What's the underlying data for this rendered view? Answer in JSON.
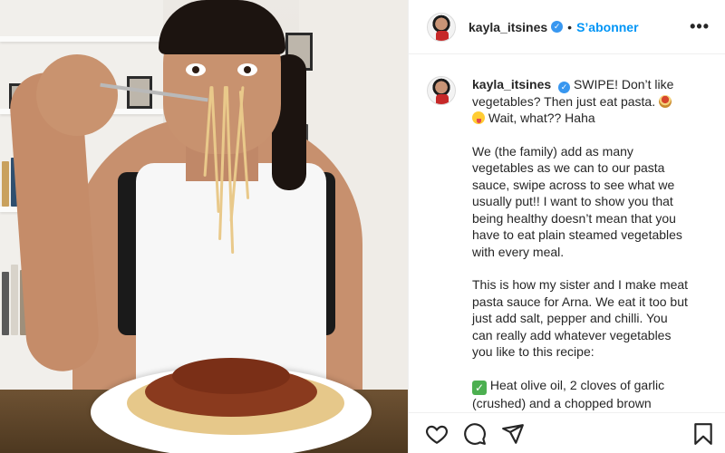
{
  "post": {
    "username": "kayla_itsines",
    "verified_icon": "verified-badge-icon",
    "separator": "•",
    "follow_label": "S’abonner",
    "more_icon": "more-options-icon"
  },
  "caption": {
    "username": "kayla_itsines",
    "line1_a": "SWIPE! Don’t like vegetables? Then just eat pasta.",
    "line1_b": "Wait, what?? Haha",
    "para2": "We (the family) add as many vegetables as we can to our pasta sauce, swipe across to see what we usually put!! I want to show you that being healthy doesn’t mean that you have to eat plain steamed vegetables with every meal.",
    "para3": "This is how my sister and I make meat pasta sauce for Arna. We eat it too but just add salt, pepper and chilli. You can really add whatever vegetables you like to this recipe:",
    "para4": "Heat olive oil, 2 cloves of garlic (crushed) and a chopped brown",
    "emoji_1": "spaghetti-emoji-icon",
    "emoji_2": "tongue-out-emoji-icon",
    "emoji_3": "check-mark-emoji-icon"
  },
  "actions": {
    "like_icon": "heart-icon",
    "comment_icon": "comment-icon",
    "share_icon": "share-icon",
    "save_icon": "bookmark-icon"
  },
  "colors": {
    "accent": "#0095f6",
    "verified": "#3897f0",
    "text": "#262626",
    "border": "#efefef"
  }
}
